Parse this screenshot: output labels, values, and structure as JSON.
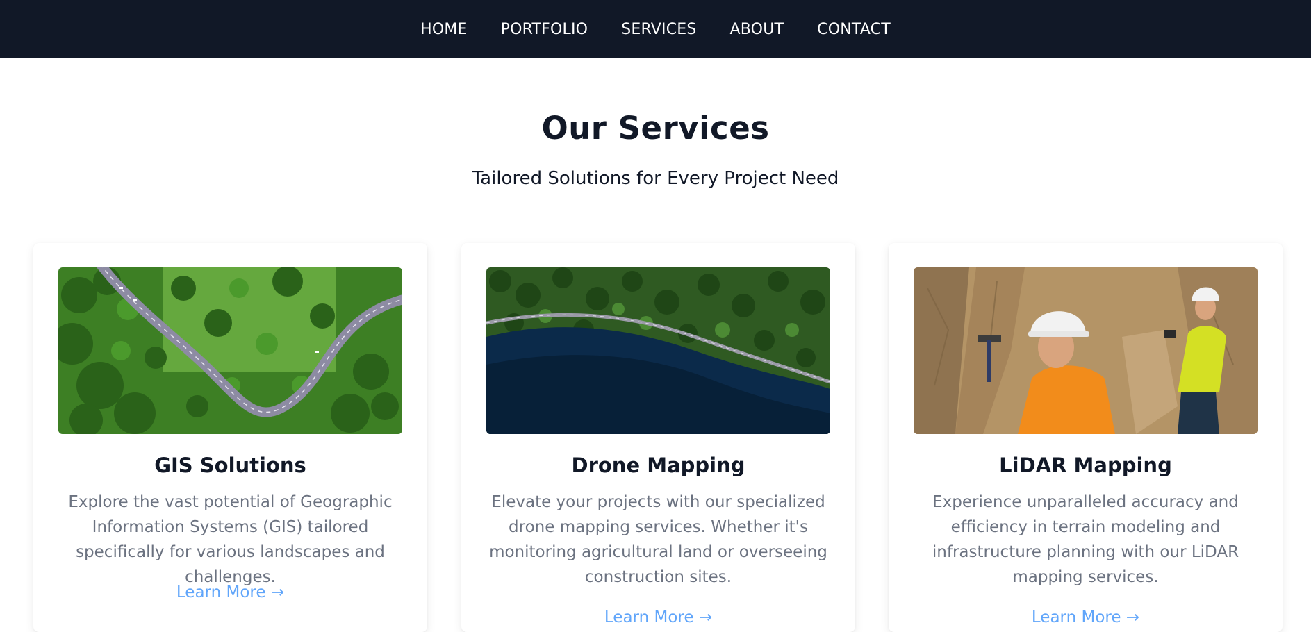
{
  "nav": {
    "items": [
      {
        "label": "HOME"
      },
      {
        "label": "PORTFOLIO"
      },
      {
        "label": "SERVICES"
      },
      {
        "label": "ABOUT"
      },
      {
        "label": "CONTACT"
      }
    ]
  },
  "services": {
    "title": "Our Services",
    "subtitle": "Tailored Solutions for Every Project Need",
    "cards": [
      {
        "title": "GIS Solutions",
        "description": "Explore the vast potential of Geographic Information Systems (GIS) tailored specifically for various landscapes and challenges.",
        "link": "Learn More →",
        "image": "aerial-winding-road-forest-photo"
      },
      {
        "title": "Drone Mapping",
        "description": "Elevate your projects with our specialized drone mapping services. Whether it's monitoring agricultural land or overseeing construction sites.",
        "link": "Learn More →",
        "image": "aerial-lake-forest-road-photo"
      },
      {
        "title": "LiDAR Mapping",
        "description": "Experience unparalleled accuracy and efficiency in terrain modeling and infrastructure planning with our LiDAR mapping services.",
        "link": "Learn More →",
        "image": "geologists-rock-face-photo"
      }
    ]
  },
  "colors": {
    "nav_bg": "#111827",
    "heading": "#111827",
    "body_text": "#6b7280",
    "link": "#60a5fa"
  }
}
